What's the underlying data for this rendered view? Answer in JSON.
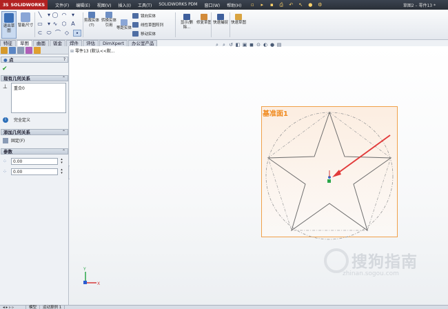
{
  "app": {
    "logo_ds": "3S",
    "logo_text": "SOLIDWORKS",
    "window_title": "草图2 – 零件13 *"
  },
  "menu": [
    "文件(F)",
    "编辑(E)",
    "视图(V)",
    "插入(I)",
    "工具(T)",
    "SOLIDWORKS PDM",
    "窗口(W)",
    "帮助(H)"
  ],
  "commands": {
    "exit_sketch": "退出草图",
    "smart_dim": "智能尺寸",
    "trim": "剪裁实体(T)",
    "convert": "转换实体引用",
    "offset": "等距实体",
    "mirror": "镜向实体",
    "linear_pattern": "线性草图阵列",
    "move": "移动实体",
    "display": "显示/删除...",
    "repair": "修复草图",
    "quick_snap": "快速捕捉",
    "rapid_sketch": "快速草图"
  },
  "tabs": [
    "特征",
    "草图",
    "曲面",
    "钣金",
    "焊件",
    "评估",
    "DimXpert",
    "办公室产品"
  ],
  "active_tab": "草图",
  "panel": {
    "title": "点",
    "existing_relations": "现有几何关系",
    "relation_item": "重合0",
    "status": "完全定义",
    "add_relations": "添加几何关系",
    "fix": "固定(F)",
    "parameters": "参数",
    "x_value": "0.00",
    "y_value": "0.00"
  },
  "tree": {
    "item": "零件13 (默认<<默..."
  },
  "viewport": {
    "plane_label": "基准面1"
  },
  "watermark": {
    "text": "搜狗指南",
    "url": "zhinan.sogou.com"
  },
  "bottom_tabs": [
    "模型",
    "运动算例 1"
  ]
}
